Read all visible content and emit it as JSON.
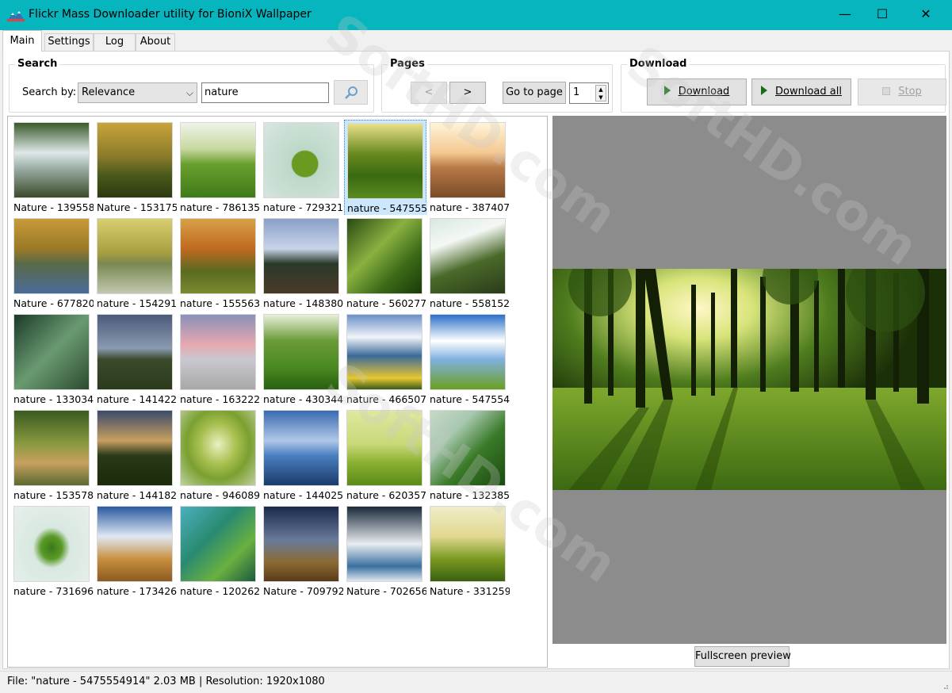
{
  "window": {
    "title": "Flickr Mass Downloader utility for BioniX Wallpaper",
    "min_glyph": "—",
    "max_glyph": "☐",
    "close_glyph": "✕"
  },
  "tabs": [
    {
      "label": "Main",
      "active": true
    },
    {
      "label": "Settings"
    },
    {
      "label": "Log"
    },
    {
      "label": "About"
    }
  ],
  "search": {
    "group_title": "Search",
    "search_by_label": "Search by:",
    "search_by_value": "Relevance",
    "query": "nature",
    "search_icon": "magnifier-icon"
  },
  "pages": {
    "group_title": "Pages",
    "prev_label": "<",
    "next_label": ">",
    "goto_label": "Go to page",
    "page_number": "1"
  },
  "download": {
    "group_title": "Download",
    "download_label": "Download",
    "download_all_label": "Download all",
    "stop_label": "Stop"
  },
  "thumbnails": [
    {
      "caption": "Nature - 139558"
    },
    {
      "caption": "Nature - 153175"
    },
    {
      "caption": "nature - 786135"
    },
    {
      "caption": "nature - 729321"
    },
    {
      "caption": "nature - 547555"
    },
    {
      "caption": "nature - 387407"
    },
    {
      "caption": "Nature - 677820"
    },
    {
      "caption": "nature - 154291"
    },
    {
      "caption": "nature - 155563"
    },
    {
      "caption": "nature - 148380"
    },
    {
      "caption": "nature - 560277"
    },
    {
      "caption": "nature - 558152"
    },
    {
      "caption": "nature - 133034"
    },
    {
      "caption": "nature - 141422"
    },
    {
      "caption": "nature - 163222"
    },
    {
      "caption": "nature - 430344"
    },
    {
      "caption": "nature - 466507"
    },
    {
      "caption": "nature - 547554"
    },
    {
      "caption": "nature - 153578"
    },
    {
      "caption": "nature - 144182"
    },
    {
      "caption": "nature - 946089"
    },
    {
      "caption": "nature - 144025"
    },
    {
      "caption": "nature - 620357"
    },
    {
      "caption": "nature - 132385"
    },
    {
      "caption": "nature - 731696"
    },
    {
      "caption": "nature - 173426"
    },
    {
      "caption": "nature - 120262"
    },
    {
      "caption": "Nature - 709792"
    },
    {
      "caption": "Nature - 702656"
    },
    {
      "caption": "Nature - 331259"
    }
  ],
  "preview": {
    "fullscreen_label": "Fullscreen preview"
  },
  "status": {
    "text": "File: \"nature - 5475554914\"  2.03 MB |  Resolution: 1920x1080"
  },
  "watermark_text": "SoftHD.com"
}
